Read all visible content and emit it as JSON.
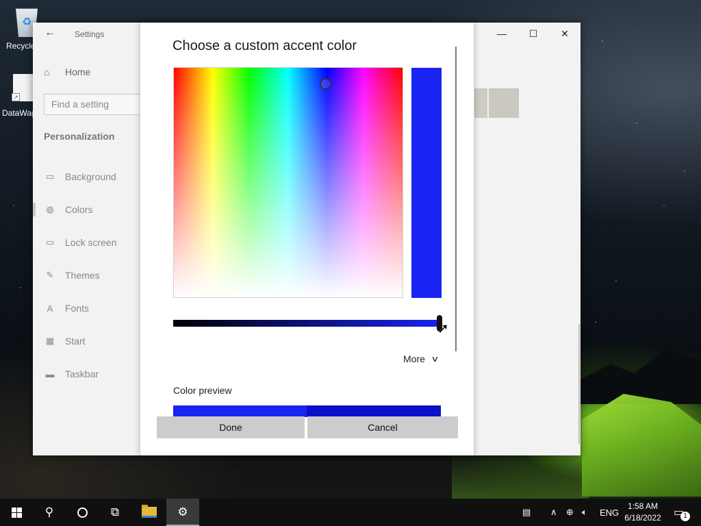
{
  "desktop": {
    "icons": [
      {
        "label": "Recycle"
      },
      {
        "label": "DataWag"
      }
    ]
  },
  "settings": {
    "app_title": "Settings",
    "home_label": "Home",
    "search_placeholder": "Find a setting",
    "section_heading": "Personalization",
    "nav_items": [
      {
        "label": "Background",
        "icon": "image-icon"
      },
      {
        "label": "Colors",
        "icon": "palette-icon"
      },
      {
        "label": "Lock screen",
        "icon": "lock-screen-icon"
      },
      {
        "label": "Themes",
        "icon": "themes-icon"
      },
      {
        "label": "Fonts",
        "icon": "fonts-icon"
      },
      {
        "label": "Start",
        "icon": "start-icon"
      },
      {
        "label": "Taskbar",
        "icon": "taskbar-icon"
      }
    ],
    "active_item": "Colors"
  },
  "dialog": {
    "title": "Choose a custom accent color",
    "selected_color": "#1923F2",
    "more_label": "More",
    "preview_label": "Color preview",
    "done_label": "Done",
    "cancel_label": "Cancel"
  },
  "taskbar": {
    "language": "ENG",
    "time": "1:58 AM",
    "date": "6/18/2022",
    "notification_count": "1"
  }
}
